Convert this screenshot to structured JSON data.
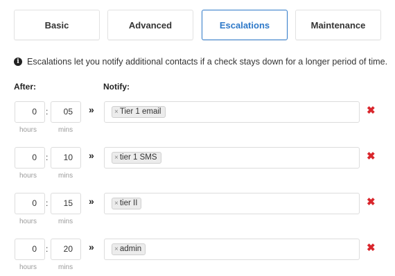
{
  "tabs": [
    {
      "label": "Basic",
      "active": false
    },
    {
      "label": "Advanced",
      "active": false
    },
    {
      "label": "Escalations",
      "active": true
    },
    {
      "label": "Maintenance",
      "active": false
    }
  ],
  "info": {
    "icon": "info-icon",
    "text": "Escalations let you notify additional contacts if a check stays down for a longer period of time."
  },
  "columns": {
    "after": "After:",
    "notify": "Notify:"
  },
  "units": {
    "hours": "hours",
    "mins": "mins",
    "separator": ":",
    "arrow": "»",
    "tag_remove": "×",
    "row_remove": "✖"
  },
  "escalations": [
    {
      "hours": "0",
      "mins": "05",
      "contact": "Tier 1 email"
    },
    {
      "hours": "0",
      "mins": "10",
      "contact": "tier 1 SMS"
    },
    {
      "hours": "0",
      "mins": "15",
      "contact": "tier II"
    },
    {
      "hours": "0",
      "mins": "20",
      "contact": "admin"
    }
  ],
  "colors": {
    "accent": "#2d78c8",
    "remove": "#d9262c"
  }
}
